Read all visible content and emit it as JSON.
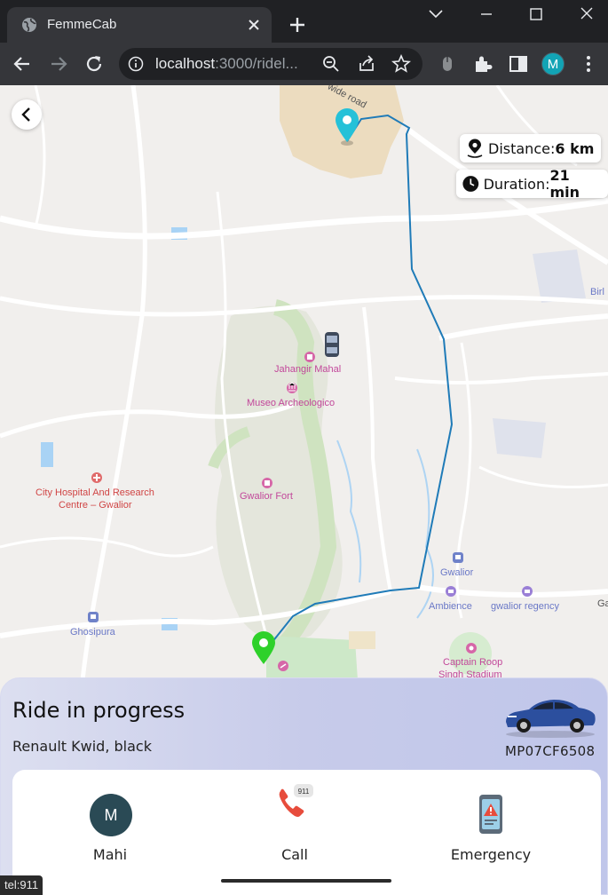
{
  "browser": {
    "tab_title": "FemmeCab",
    "url_host": "localhost",
    "url_rest": ":3000/ridel...",
    "profile_initial": "M"
  },
  "map": {
    "labels": {
      "road": "wide road",
      "jahangir": "Jahangir Mahal",
      "museo": "Museo Archeologico",
      "city_hospital_1": "City Hospital And Research",
      "city_hospital_2": "Centre – Gwalior",
      "gwalior_fort": "Gwalior Fort",
      "gwalior": "Gwalior",
      "ambience": "Ambience",
      "gwalior_regency": "gwalior regency",
      "ghosipura": "Ghosipura",
      "captain_roop_1": "Captain Roop",
      "captain_roop_2": "Singh Stadium",
      "birla": "Birl",
      "ga": "Ga"
    },
    "distance_label": "Distance:",
    "distance_value": "6 km",
    "duration_label": "Duration:",
    "duration_value": "21 min",
    "route_color": "#1f7bb8"
  },
  "ride": {
    "status_title": "Ride in progress",
    "car_description": "Renault Kwid, black",
    "plate": "MP07CF6508"
  },
  "actions": {
    "driver_initial": "M",
    "driver_name": "Mahi",
    "call_label": "Call",
    "call_badge": "911",
    "emergency_label": "Emergency"
  },
  "status_bar_link": "tel:911",
  "colors": {
    "accent": "#12a4b5",
    "sheet_gradient_start": "#dcdff0",
    "sheet_gradient_end": "#c0c6ea",
    "avatar_bg": "#2a4a55"
  }
}
